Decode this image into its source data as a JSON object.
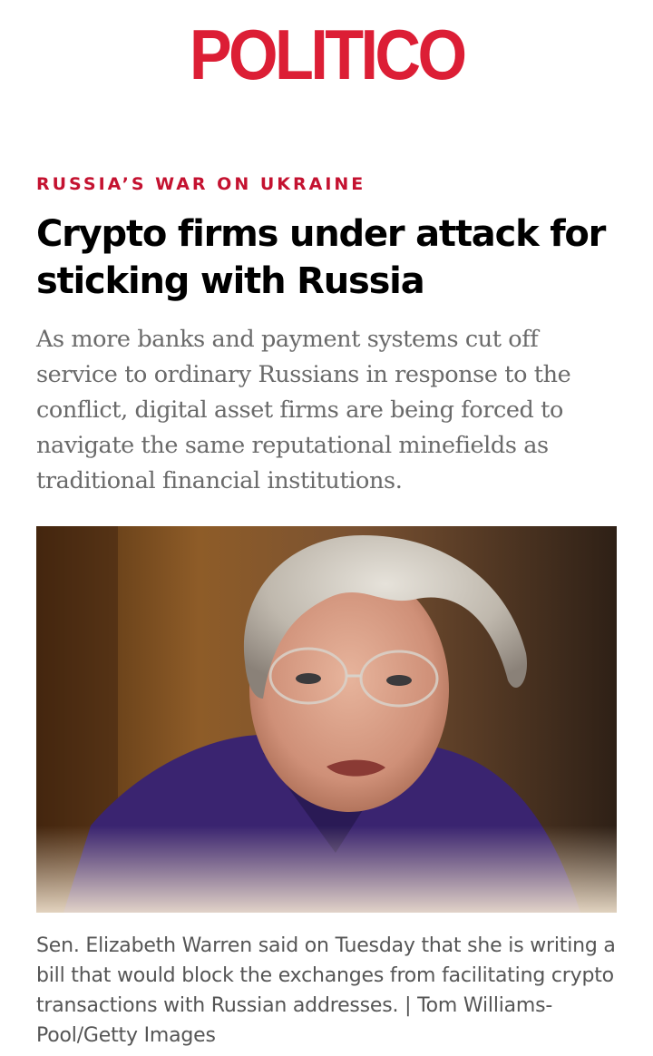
{
  "brand": {
    "logo_text": "POLITICO",
    "accent_color": "#dc1e35"
  },
  "article": {
    "kicker": "RUSSIA’S WAR ON UKRAINE",
    "headline": "Crypto firms under attack for sticking with Russia",
    "dek": "As more banks and payment systems cut off service to ordinary Russians in response to the conflict, digital asset firms are being forced to navigate the same reputational minefields as traditional financial institutions.",
    "image": {
      "alt": "Sen. Elizabeth Warren"
    },
    "caption": {
      "text": "Sen. Elizabeth Warren said on Tuesday that she is writing a bill that would block the exchanges from facilitating crypto transactions with Russian addresses.",
      "separator": " | ",
      "credit": "Tom Williams-Pool/Getty Images"
    }
  }
}
